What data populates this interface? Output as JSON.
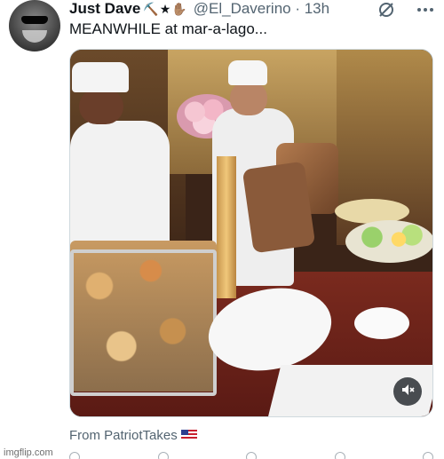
{
  "tweet": {
    "author_name": "Just Dave",
    "author_emojis": "⛏️★✋🏽",
    "handle_and_time": "@El_Daverino · 13h",
    "text": "MEANWHILE at mar-a-lago...",
    "source": "From PatriotTakes"
  },
  "icons": {
    "grok": "grok-icon",
    "more": "more-icon",
    "mute": "speaker-muted-icon",
    "flag": "us-flag-icon"
  },
  "watermark": "imgflip.com",
  "colors": {
    "text_primary": "#0f1419",
    "text_secondary": "#536471",
    "border": "#cfd9de"
  }
}
